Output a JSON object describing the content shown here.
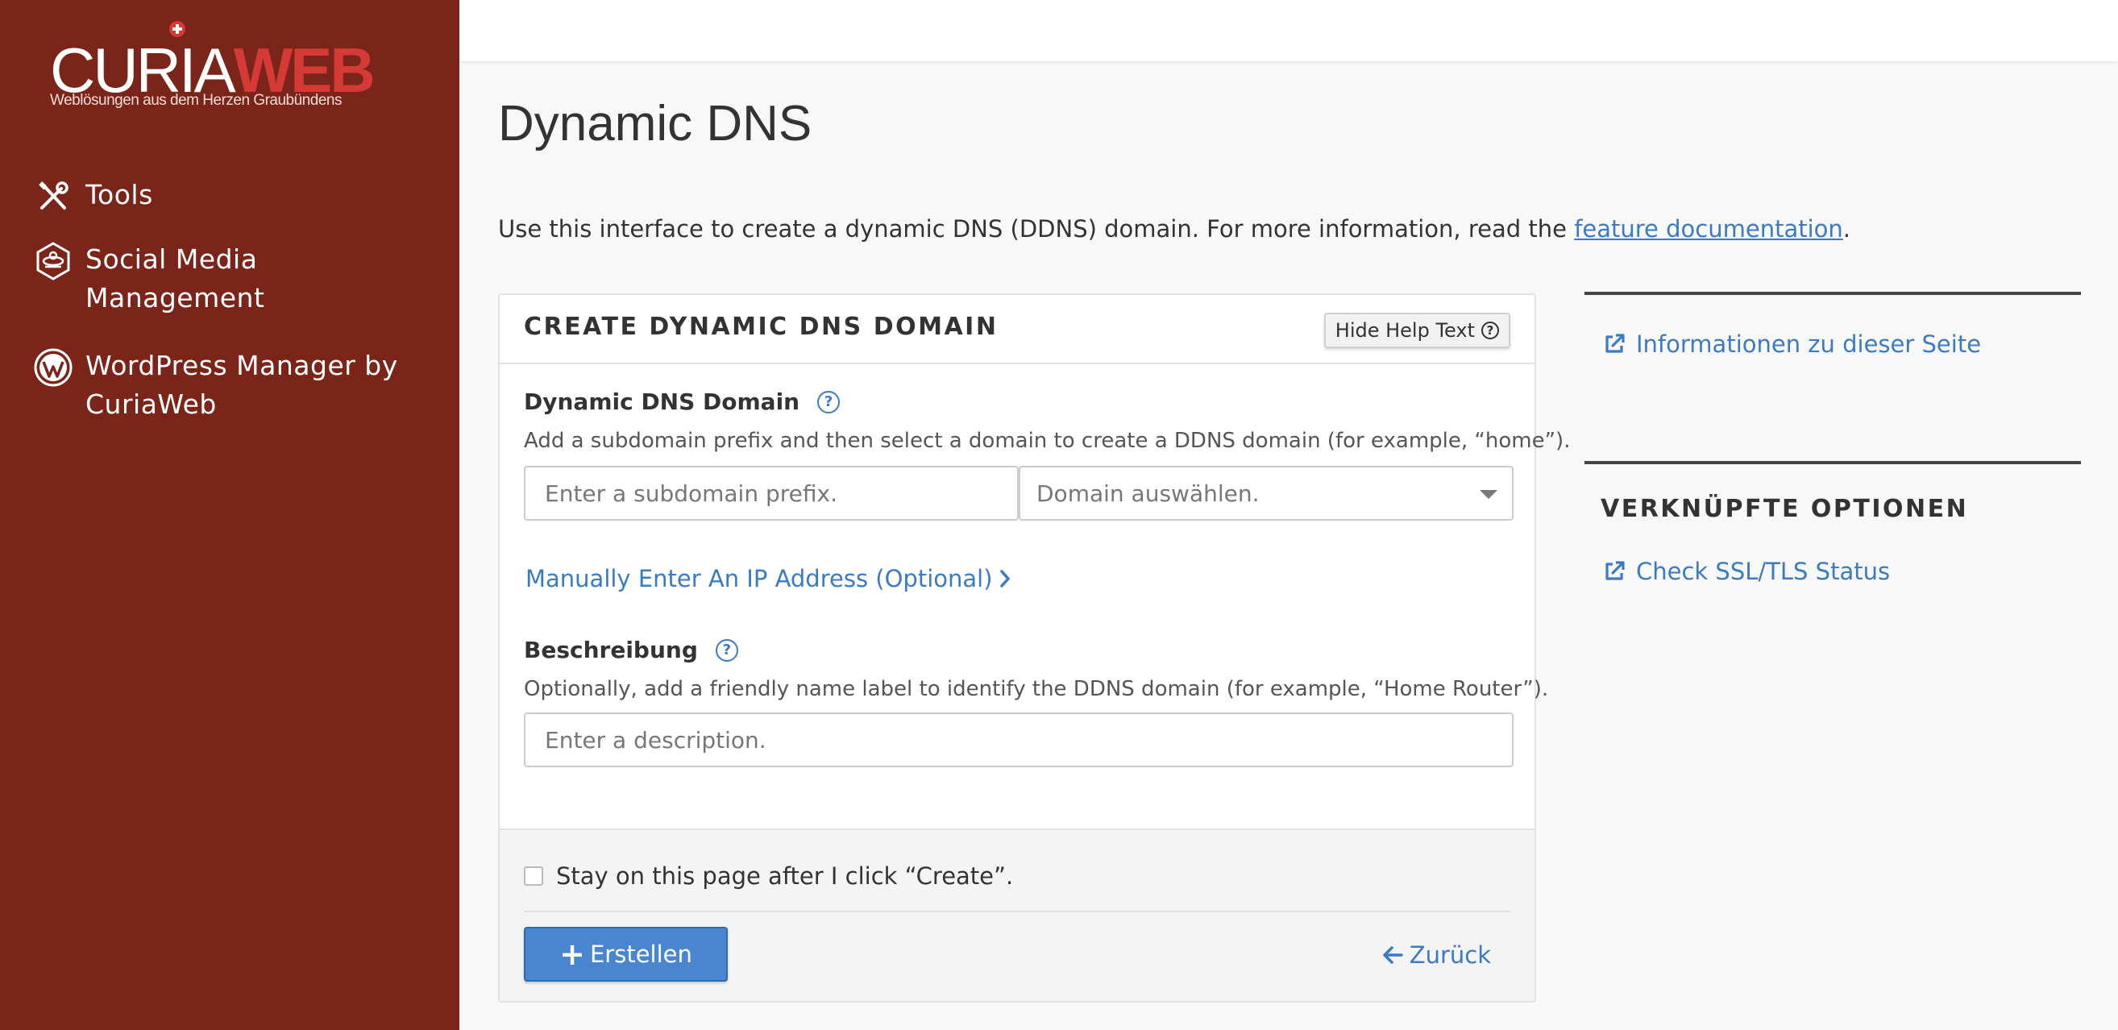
{
  "brand": {
    "logo_word1": "CURIA",
    "logo_word2": "WEB",
    "tagline": "Weblösungen aus dem Herzen Graubündens"
  },
  "sidebar": {
    "items": [
      {
        "label": "Tools",
        "icon": "tools-icon"
      },
      {
        "label": "Social Media Management",
        "icon": "social-media-icon"
      },
      {
        "label": "WordPress Manager by CuriaWeb",
        "icon": "wordpress-icon"
      }
    ]
  },
  "page": {
    "title": "Dynamic DNS",
    "intro_text": "Use this interface to create a dynamic DNS (DDNS) domain. For more information, read the ",
    "intro_link": "feature documentation",
    "intro_end": "."
  },
  "panel": {
    "title": "CREATE DYNAMIC DNS DOMAIN",
    "hide_help_label": "Hide Help Text",
    "domain_label": "Dynamic DNS Domain",
    "domain_help": "Add a subdomain prefix and then select a domain to create a DDNS domain (for example, “home”).",
    "subdomain_placeholder": "Enter a subdomain prefix.",
    "domain_select_value": "Domain auswählen.",
    "manual_ip_link": "Manually Enter An IP Address (Optional)",
    "description_label": "Beschreibung",
    "description_help": "Optionally, add a friendly name label to identify the DDNS domain (for example, “Home Router”).",
    "description_placeholder": "Enter a description.",
    "stay_checkbox_label": "Stay on this page after I click “Create”.",
    "create_button": "Erstellen",
    "back_link": "Zurück"
  },
  "right_column": {
    "info_link": "Informationen zu dieser Seite",
    "related_title": "VERKNÜPFTE OPTIONEN",
    "related_links": [
      "Check SSL/TLS Status"
    ]
  },
  "colors": {
    "sidebar_bg": "#7b2419",
    "accent_red": "#d53a36",
    "link_blue": "#3a7bc4",
    "button_blue": "#4a86cf"
  }
}
